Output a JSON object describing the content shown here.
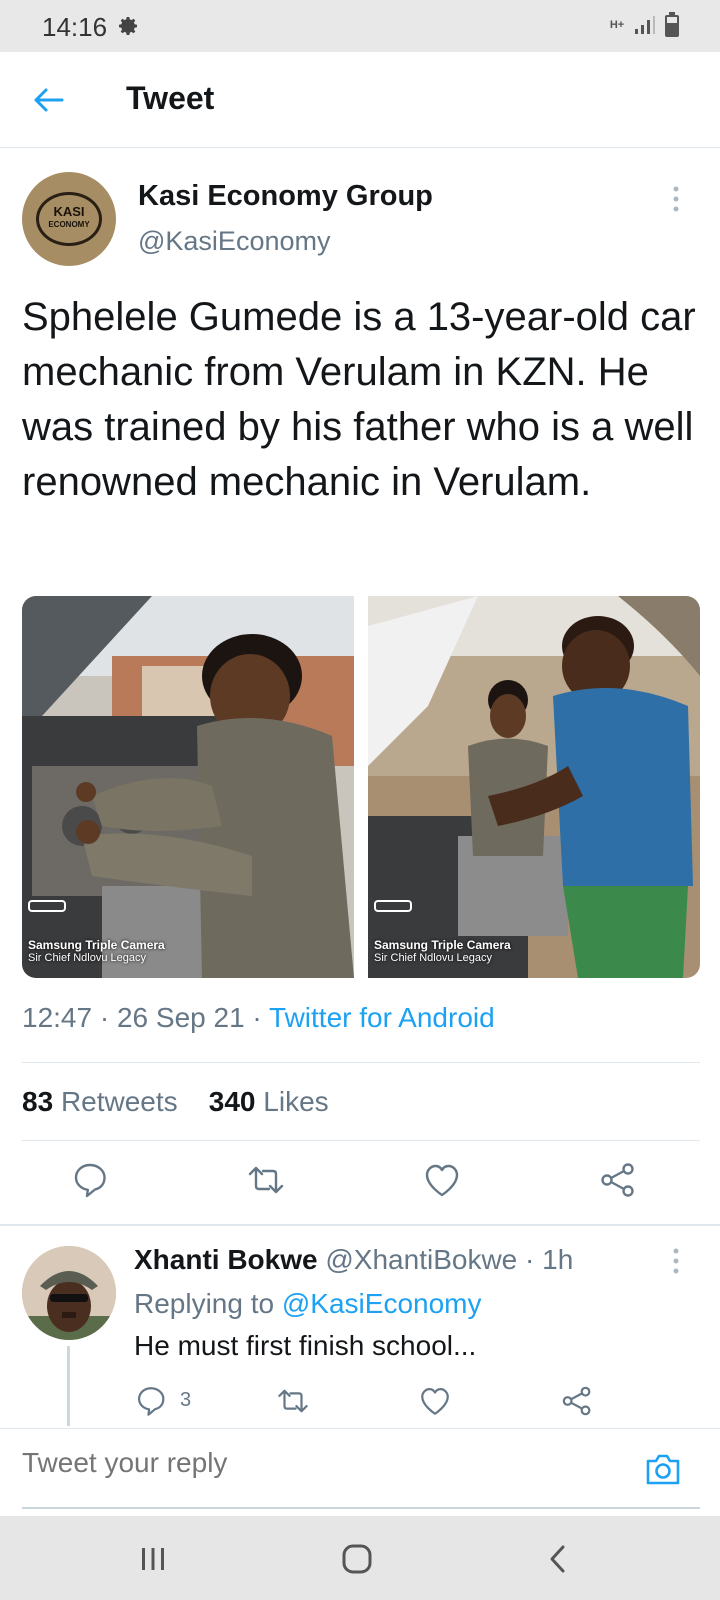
{
  "status_bar": {
    "time": "14:16",
    "network_type": "H+",
    "icons": [
      "gear-icon",
      "signal-icon",
      "battery-icon"
    ]
  },
  "header": {
    "title": "Tweet",
    "back_icon": "arrow-left-icon"
  },
  "tweet": {
    "avatar_line1": "KASI",
    "avatar_line2": "ECONOMY",
    "author_name": "Kasi Economy Group",
    "author_handle": "@KasiEconomy",
    "text": "Sphelele Gumede is a 13-year-old car mechanic from Verulam in KZN. He was trained by his father who is a well renowned mechanic in Verulam.",
    "photos": [
      {
        "watermark_title": "Samsung Triple Camera",
        "watermark_sub": "Sir Chief Ndlovu Legacy"
      },
      {
        "watermark_title": "Samsung Triple Camera",
        "watermark_sub": "Sir Chief Ndlovu Legacy"
      }
    ],
    "time": "12:47",
    "date": "26 Sep 21",
    "source": "Twitter for Android",
    "retweets_count": "83",
    "retweets_label": "Retweets",
    "likes_count": "340",
    "likes_label": "Likes"
  },
  "reply": {
    "name": "Xhanti Bokwe",
    "handle": "@XhantiBokwe",
    "time": "1h",
    "replying_label": "Replying to",
    "replying_to": "@KasiEconomy",
    "text": "He must first finish school...",
    "reply_count": "3"
  },
  "reply_bar": {
    "placeholder": "Tweet your reply"
  },
  "colors": {
    "accent": "#1da1f2",
    "secondary_text": "#657786",
    "primary_text": "#14171a"
  }
}
